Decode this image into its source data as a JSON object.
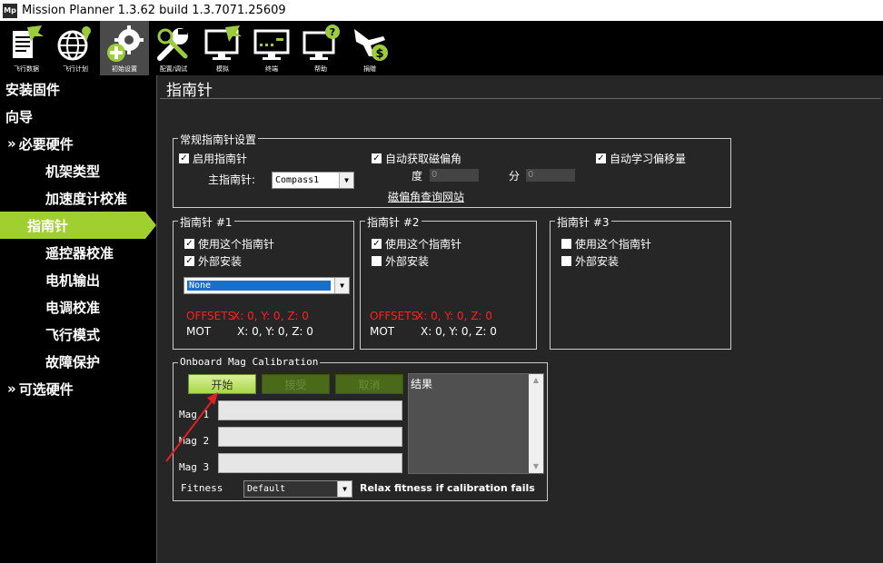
{
  "window": {
    "title": "Mission Planner 1.3.62 build 1.3.7071.25609",
    "logo": "Mp"
  },
  "toolbar": {
    "items": [
      {
        "label": "飞行数据",
        "icon": "flight-data-icon"
      },
      {
        "label": "飞行计划",
        "icon": "flight-plan-icon"
      },
      {
        "label": "初始设置",
        "icon": "initial-setup-icon",
        "active": true
      },
      {
        "label": "配置/调试",
        "icon": "config-tuning-icon"
      },
      {
        "label": "模拟",
        "icon": "simulation-icon"
      },
      {
        "label": "终端",
        "icon": "terminal-icon"
      },
      {
        "label": "帮助",
        "icon": "help-icon"
      },
      {
        "label": "捐赠",
        "icon": "donate-icon"
      }
    ]
  },
  "sidebar": {
    "items": [
      {
        "label": "安装固件",
        "indent": 0
      },
      {
        "label": "向导",
        "indent": 0
      },
      {
        "label": "必要硬件",
        "indent": 0,
        "chevron": "»"
      },
      {
        "label": "机架类型",
        "indent": 2
      },
      {
        "label": "加速度计校准",
        "indent": 2
      },
      {
        "label": "指南针",
        "indent": 1,
        "active": true
      },
      {
        "label": "遥控器校准",
        "indent": 2
      },
      {
        "label": "电机输出",
        "indent": 2
      },
      {
        "label": "电调校准",
        "indent": 2
      },
      {
        "label": "飞行模式",
        "indent": 2
      },
      {
        "label": "故障保护",
        "indent": 2
      },
      {
        "label": "可选硬件",
        "indent": 0,
        "chevron": "»"
      }
    ]
  },
  "main": {
    "title": "指南针",
    "general": {
      "legend": "常规指南针设置",
      "enable_compass": "启用指南针",
      "auto_declination": "自动获取磁偏角",
      "auto_learn": "自动学习偏移量",
      "primary_label": "主指南针:",
      "primary_value": "Compass1",
      "deg_label": "度",
      "deg_value": "0",
      "min_label": "分",
      "min_value": "0",
      "website_link": "磁偏角查询网站"
    },
    "compass1": {
      "legend": "指南针 #1",
      "use": "使用这个指南针",
      "external": "外部安装",
      "orientation": "None",
      "offsets_label": "OFFSETS",
      "offsets_value": "X: 0,   Y: 0,   Z: 0",
      "mot_label": "MOT",
      "mot_value": "X: 0,   Y: 0,   Z: 0"
    },
    "compass2": {
      "legend": "指南针 #2",
      "use": "使用这个指南针",
      "external": "外部安装",
      "offsets_label": "OFFSETS",
      "offsets_value": "X: 0,   Y: 0,   Z: 0",
      "mot_label": "MOT",
      "mot_value": "X: 0,   Y: 0,   Z: 0"
    },
    "compass3": {
      "legend": "指南针 #3",
      "use": "使用这个指南针",
      "external": "外部安装"
    },
    "onboard": {
      "legend": "Onboard Mag Calibration",
      "start": "开始",
      "accept": "接受",
      "cancel": "取消",
      "results": "结果",
      "mag1": "Mag 1",
      "mag2": "Mag 2",
      "mag3": "Mag 3",
      "fitness_label": "Fitness",
      "fitness_value": "Default",
      "relax": "Relax fitness if calibration fails"
    }
  },
  "colors": {
    "accent": "#a0d030",
    "offsets": "#ff2020"
  }
}
